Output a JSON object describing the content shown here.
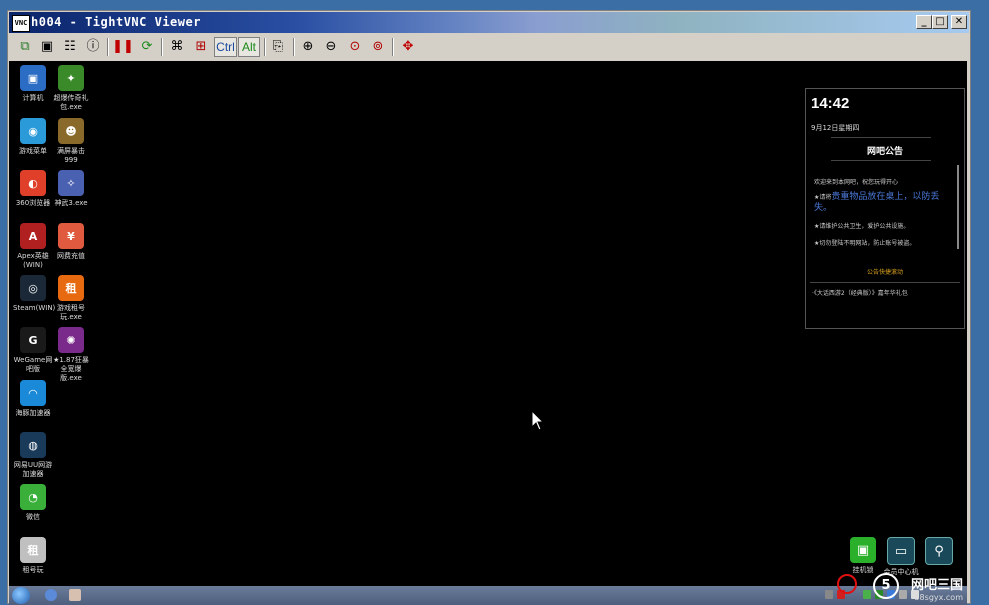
{
  "window": {
    "title": "h004 - TightVNC Viewer",
    "icon_text": "VNC",
    "minimize": "_",
    "maximize": "□",
    "close": "✕"
  },
  "toolbar": {
    "ctrl_label": "Ctrl",
    "alt_label": "Alt"
  },
  "desktop_icons": [
    {
      "label": "计算机",
      "color": "#2b6cc4",
      "glyph": "▣"
    },
    {
      "label": "超爆传奇礼包.exe",
      "color": "#3a8a2a",
      "glyph": "✦"
    },
    {
      "label": "游戏菜单",
      "color": "#2a9ad8",
      "glyph": "◉"
    },
    {
      "label": "满屏暴击999",
      "color": "#8a6a2a",
      "glyph": "☻"
    },
    {
      "label": "360浏览器",
      "color": "#e0402a",
      "glyph": "◐"
    },
    {
      "label": "神武3.exe",
      "color": "#4a60b0",
      "glyph": "✧"
    },
    {
      "label": "Apex英雄(WIN)",
      "color": "#b02020",
      "glyph": "A"
    },
    {
      "label": "网费充值",
      "color": "#e05a40",
      "glyph": "¥"
    },
    {
      "label": "Steam(WIN)",
      "color": "#1b2838",
      "glyph": "◎"
    },
    {
      "label": "游戏租号玩.exe",
      "color": "#e86a10",
      "glyph": "租"
    },
    {
      "label": "WeGame网吧版",
      "color": "#1a1a1a",
      "glyph": "G"
    },
    {
      "label": "★1.87狂暴全宽爆版.exe",
      "color": "#7a2a8a",
      "glyph": "✺"
    },
    {
      "label": "海豚加速器",
      "color": "#1a8ad8",
      "glyph": "◠"
    },
    {
      "label": "网易UU网游加速器",
      "color": "#1a3a5a",
      "glyph": "◍"
    },
    {
      "label": "微信",
      "color": "#3ab03a",
      "glyph": "◔"
    },
    {
      "label": "租号玩",
      "color": "#c0c0c0",
      "glyph": "租"
    }
  ],
  "panel": {
    "time": "14:42",
    "date": "9月12日星期四",
    "notice_title": "网吧公告",
    "line1": "欢迎来到本网吧，祝您玩得开心",
    "line2_prefix": "★请将",
    "line2_highlight": "贵重物品放在桌上，以防丢失。",
    "line3": "★请维护公共卫生，爱护公共设施。",
    "line4": "★切勿登陆不明网站，防止账号被盗。",
    "scrolling": "公告快捷滚动",
    "gift": "·《大话西游2（经典版）》嘉年华礼包"
  },
  "dock": [
    {
      "label": "挂机锁",
      "color": "#2bb02b",
      "glyph": "🔒"
    },
    {
      "label": "会员中心机",
      "color": "#1a4a5a",
      "glyph": "▭"
    },
    {
      "label": "",
      "color": "#1a4a5a",
      "glyph": "⚲"
    }
  ],
  "watermark": {
    "main": "网吧三国",
    "sub": "58sgyx.com",
    "circle": "5"
  }
}
